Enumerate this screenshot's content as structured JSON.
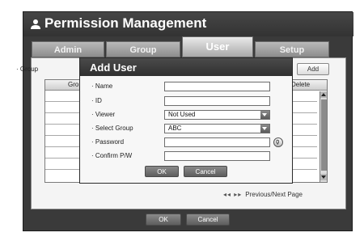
{
  "window": {
    "title": "Permission Management",
    "title_icon": "user-icon"
  },
  "tabs": [
    {
      "label": "Admin",
      "active": false
    },
    {
      "label": "Group",
      "active": false
    },
    {
      "label": "User",
      "active": true
    },
    {
      "label": "Setup",
      "active": false
    }
  ],
  "group_filter": {
    "label": "· Group"
  },
  "add_button": "Add",
  "user_table": {
    "columns": [
      "Gro",
      "Delete"
    ]
  },
  "pagination": {
    "icon": "◂◂ ▸▸",
    "label": "Previous/Next Page"
  },
  "footer": {
    "ok_label": "OK",
    "cancel_label": "Cancel"
  },
  "dialog": {
    "title": "Add User",
    "fields": {
      "name": {
        "label": "· Name",
        "value": ""
      },
      "id": {
        "label": "· ID",
        "value": ""
      },
      "viewer": {
        "label": "· Viewer",
        "value": "Not Used"
      },
      "select_group": {
        "label": "· Select Group",
        "value": "ABC"
      },
      "password": {
        "label": "· Password",
        "value": "",
        "icon": "keypad-icon"
      },
      "confirm_pw": {
        "label": "· Confirm P/W",
        "value": ""
      }
    },
    "ok_label": "OK",
    "cancel_label": "Cancel"
  }
}
